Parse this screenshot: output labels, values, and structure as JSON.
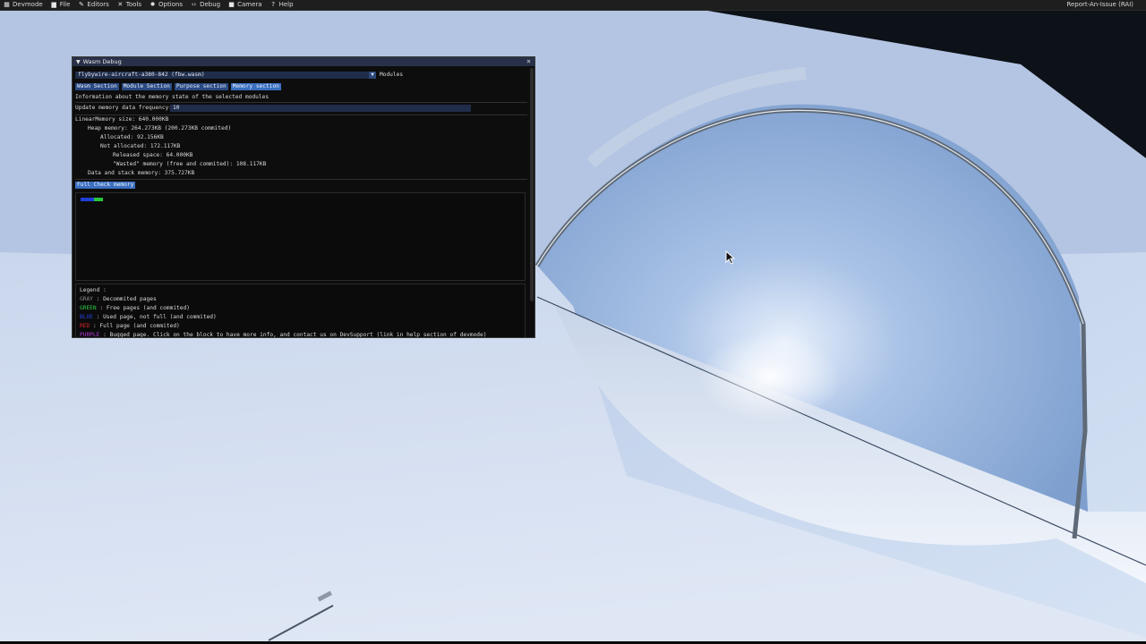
{
  "menubar": {
    "items": [
      {
        "label": "Devmode",
        "icon": "devmode-icon"
      },
      {
        "label": "File",
        "icon": "folder-icon"
      },
      {
        "label": "Editors",
        "icon": "pencil-icon"
      },
      {
        "label": "Tools",
        "icon": "wrench-icon"
      },
      {
        "label": "Options",
        "icon": "gear-icon"
      },
      {
        "label": "Debug",
        "icon": "code-icon"
      },
      {
        "label": "Camera",
        "icon": "camera-icon"
      },
      {
        "label": "Help",
        "icon": "help-icon"
      }
    ],
    "right_label": "Report-An-Issue (RAI)"
  },
  "window": {
    "title": "Wasm Debug",
    "module_select": "flybywire-aircraft-a380-842 (fbw.wasm)",
    "module_select_label": "Modules",
    "tabs": [
      "Wasm Section",
      "Module Section",
      "Purpose section",
      "Memory section"
    ],
    "active_tab": "Memory section",
    "info": "Information about the memory state of the selected modules",
    "update_label": "Update memory data frequency:",
    "update_value": "10",
    "stats": {
      "linear": "LinearMemory size: 640.000KB",
      "heap": "Heap memory: 264.273KB  (200.273KB commited)",
      "allocated": "Allocated: 92.156KB",
      "not_allocated": "Not allocated: 172.117KB",
      "released": "Released space: 64.000KB",
      "wasted": "\"Wasted\" memory (free and commited): 108.117KB",
      "data_stack": "Data and stack memory: 375.727KB"
    },
    "full_check_label": "Full Check memory",
    "pages": [
      {
        "color": "#1f3fd8"
      },
      {
        "color": "#1f3fd8"
      },
      {
        "color": "#1f3fd8"
      },
      {
        "color": "#27c43a"
      },
      {
        "color": "#27c43a"
      }
    ],
    "legend": {
      "title": "Legend :",
      "items": [
        {
          "key": "GRAY",
          "text": " : Decommited pages",
          "color": "#8a8a8a"
        },
        {
          "key": "GREEN",
          "text": " : Free pages (and commited)",
          "color": "#2fd04a"
        },
        {
          "key": "BLUE",
          "text": " : Used page, not full (and commited)",
          "color": "#2345e0"
        },
        {
          "key": "RED",
          "text": " : Full page (and commited)",
          "color": "#e02828"
        },
        {
          "key": "PURPLE",
          "text": " : Bugged page. Click on the block to have more info, and contact us on DevSupport (link in help section of devmode)",
          "color": "#b43ad8"
        }
      ]
    }
  },
  "colors": {
    "title_bar": "#283149",
    "tab": "#2a4a82",
    "tab_active": "#3b6fc0",
    "input_bg": "#1f2d4a"
  }
}
